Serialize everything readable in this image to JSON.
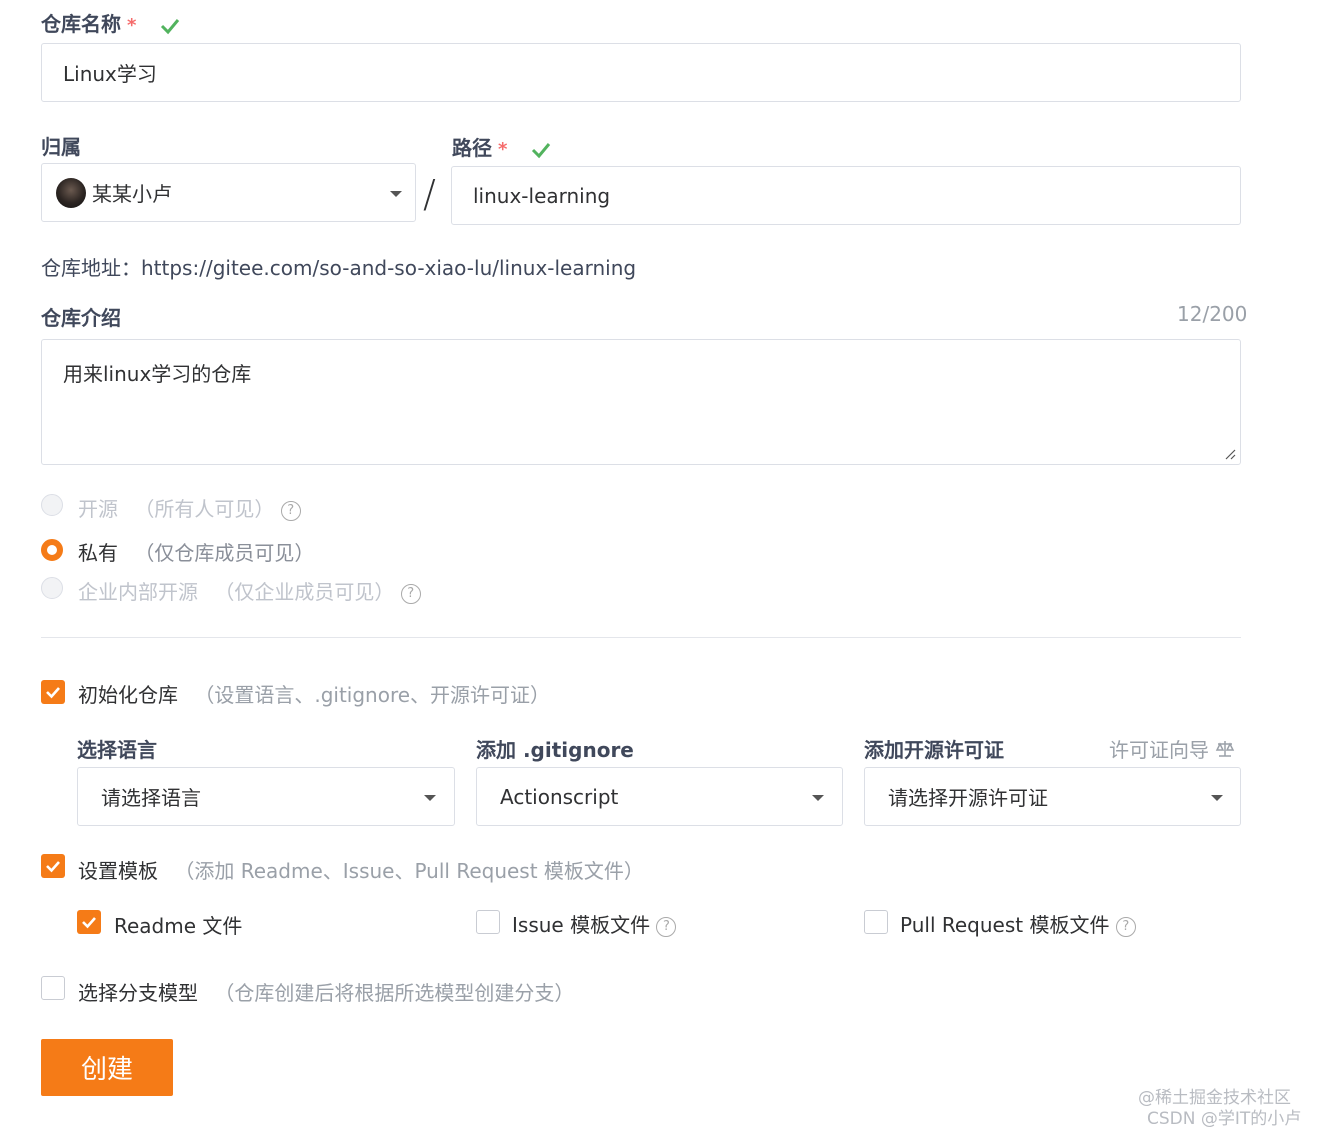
{
  "repo_name": {
    "label": "仓库名称",
    "required_mark": "*",
    "value": "Linux学习"
  },
  "owner": {
    "label": "归属",
    "value": "某某小卢"
  },
  "path": {
    "label": "路径",
    "required_mark": "*",
    "separator": "/",
    "value": "linux-learning"
  },
  "repo_url": {
    "prefix": "仓库地址：",
    "url": "https://gitee.com/so-and-so-xiao-lu/linux-learning"
  },
  "description": {
    "label": "仓库介绍",
    "counter": "12/200",
    "value": "用来linux学习的仓库"
  },
  "visibility": {
    "options": [
      {
        "label": "开源",
        "hint": "（所有人可见）",
        "selected": false,
        "disabled": true,
        "help": "?"
      },
      {
        "label": "私有",
        "hint": "（仅仓库成员可见）",
        "selected": true,
        "disabled": false
      },
      {
        "label": "企业内部开源",
        "hint": "（仅企业成员可见）",
        "selected": false,
        "disabled": true,
        "help": "?"
      }
    ]
  },
  "init_repo": {
    "label": "初始化仓库",
    "hint": "（设置语言、.gitignore、开源许可证）",
    "checked": true
  },
  "language": {
    "label": "选择语言",
    "value": "请选择语言"
  },
  "gitignore": {
    "label": "添加 .gitignore",
    "value": "Actionscript"
  },
  "license": {
    "label": "添加开源许可证",
    "guide": "许可证向导",
    "guide_icon": "scale-icon",
    "value": "请选择开源许可证"
  },
  "template": {
    "label": "设置模板",
    "hint": "（添加 Readme、Issue、Pull Request 模板文件）",
    "checked": true
  },
  "template_files": [
    {
      "label": "Readme 文件",
      "checked": true
    },
    {
      "label": "Issue 模板文件",
      "checked": false,
      "help": "?"
    },
    {
      "label": "Pull Request 模板文件",
      "checked": false,
      "help": "?"
    }
  ],
  "branch_model": {
    "label": "选择分支模型",
    "hint": "（仓库创建后将根据所选模型创建分支）",
    "checked": false
  },
  "submit": {
    "label": "创建"
  },
  "watermark": {
    "line1": "@稀土掘金技术社区",
    "line2": "CSDN @学IT的小卢"
  },
  "colors": {
    "accent": "#f57b17",
    "success": "#52b35e",
    "required": "#f56c6c"
  }
}
